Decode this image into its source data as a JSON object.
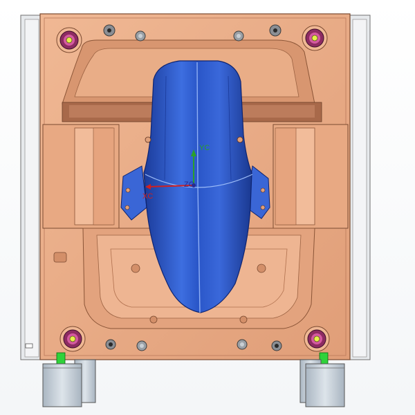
{
  "viewport": {
    "triad": {
      "yc_label": "YC",
      "xc_label": "XC",
      "zc_label": "ZC"
    },
    "colors": {
      "mold_plate": "#e8a983",
      "mold_plate_dark": "#c98a66",
      "cavity_shadow": "#b07a58",
      "part_blue": "#2f5fd0",
      "part_blue_dark": "#1e3fa0",
      "guide_pillar": "#c6d0da",
      "guide_bushing": "#a0306a",
      "green_marker": "#2fd23a",
      "frame_gray": "#dfe3e7",
      "axis_y": "#2aa02a",
      "axis_x": "#d02020"
    }
  }
}
